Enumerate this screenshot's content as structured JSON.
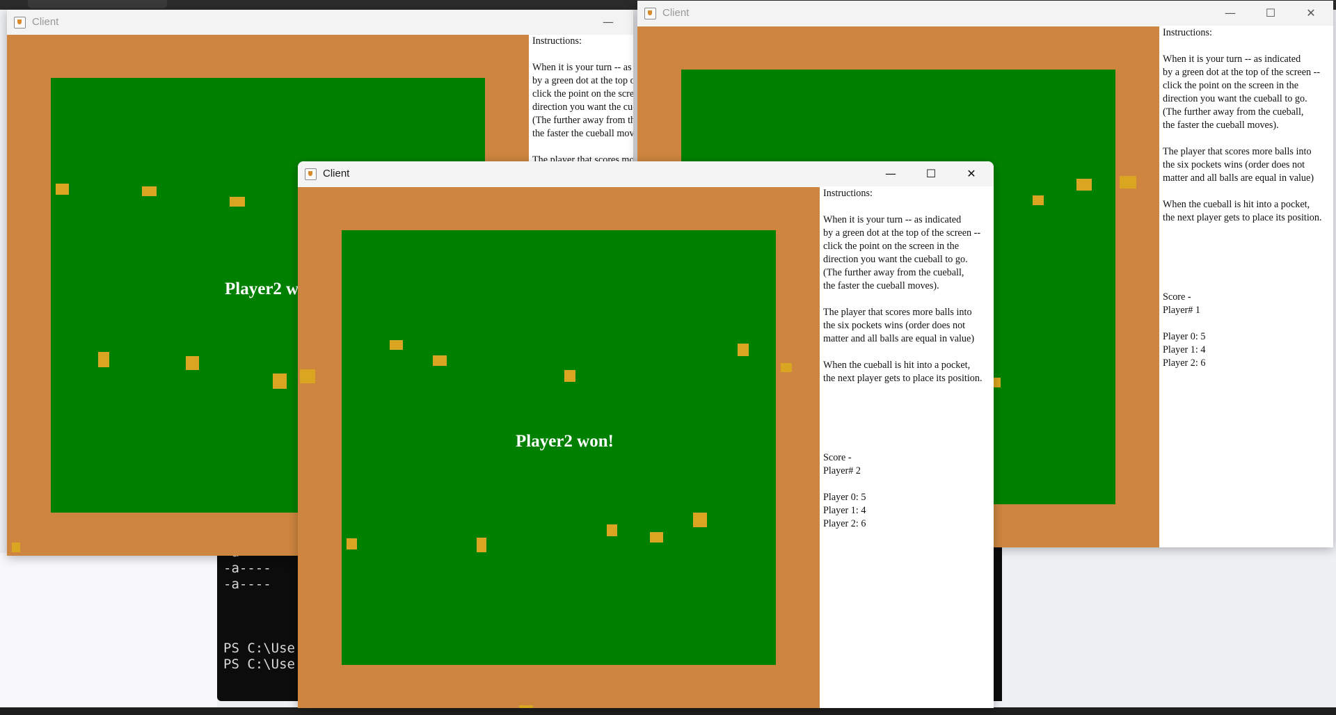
{
  "window_title": "Client",
  "title_buttons": {
    "minimize": "—",
    "maximize": "☐",
    "close": "✕"
  },
  "instructions": [
    "Instructions:",
    "",
    "When it is your turn -- as indicated",
    "by a green dot at the top of the screen --",
    "click the point on the screen in the",
    "direction you want the cueball to go.",
    "(The further away from the cueball,",
    "the faster the cueball moves).",
    "",
    "The player that scores more balls into",
    "the six pockets wins (order does not",
    "matter and all balls are equal in value)",
    "",
    "When the cueball is hit into a pocket,",
    "the next player gets to place its position."
  ],
  "win_message": "Player2 won!",
  "win_message_partial": "Player2 w",
  "score_heading": "Score -",
  "front": {
    "player_label": "Player# 2"
  },
  "right": {
    "player_label": "Player# 1"
  },
  "scores": [
    "Player 0: 5",
    "Player 1: 4",
    "Player 2: 6"
  ],
  "terminal_lines": [
    "-a----",
    "-a----",
    "-a----",
    "",
    "",
    "PS C:\\Use",
    "PS C:\\Use"
  ],
  "colors": {
    "table": "#cd853f",
    "felt": "#008000",
    "ball": "#daa520",
    "titlebar": "#f3f3f3"
  }
}
